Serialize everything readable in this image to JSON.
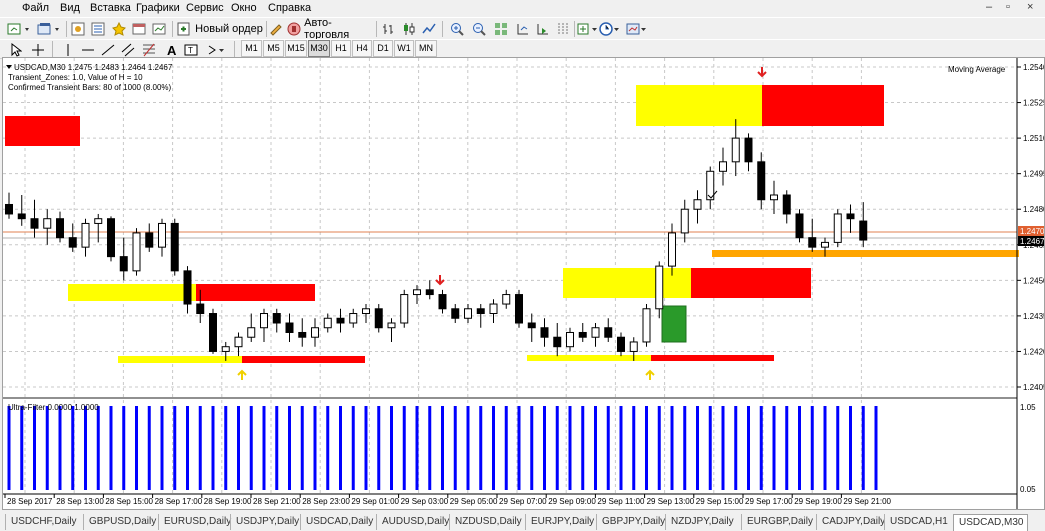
{
  "menu": [
    "Файл",
    "Вид",
    "Вставка",
    "Графики",
    "Сервис",
    "Окно",
    "Справка"
  ],
  "window_controls": [
    "–",
    "▫",
    "×"
  ],
  "toolbar1": {
    "new_order": "Новый ордер",
    "autotrading": "Авто-торговля"
  },
  "timeframes": [
    "M1",
    "M5",
    "M15",
    "M30",
    "H1",
    "H4",
    "D1",
    "W1",
    "MN"
  ],
  "active_timeframe": "M30",
  "chart": {
    "info_line1": "USDCAD,M30  1.2475 1.2483 1.2464 1.2467",
    "info_line2": "Transient_Zones: 1.0, Value of H = 10",
    "info_line3": "Confirmed Transient Bars: 80 of 1000 (8.00%)",
    "moving_average_label": "Moving Average",
    "price_ticks": [
      "1.2540",
      "1.2525",
      "1.2510",
      "1.2495",
      "1.2480",
      "1.2465",
      "1.2450",
      "1.2435",
      "1.2420",
      "1.2405"
    ],
    "current_price": "1.2467",
    "line_price": "1.2470",
    "indicator_label": "Ultra-Filter 0.0000 1.0000",
    "indicator_ticks": [
      "1.05",
      "0.05"
    ],
    "time_ticks": [
      "28 Sep 2017",
      "28 Sep 13:00",
      "28 Sep 15:00",
      "28 Sep 17:00",
      "28 Sep 19:00",
      "28 Sep 21:00",
      "28 Sep 23:00",
      "29 Sep 01:00",
      "29 Sep 03:00",
      "29 Sep 05:00",
      "29 Sep 07:00",
      "29 Sep 09:00",
      "29 Sep 11:00",
      "29 Sep 13:00",
      "29 Sep 15:00",
      "29 Sep 17:00",
      "29 Sep 19:00",
      "29 Sep 21:00"
    ]
  },
  "tabs": [
    "USDCHF,Daily",
    "GBPUSD,Daily",
    "EURUSD,Daily",
    "USDJPY,Daily",
    "USDCAD,Daily",
    "AUDUSD,Daily",
    "NZDUSD,Daily",
    "EURJPY,Daily",
    "GBPJPY,Daily",
    "NZDJPY,Daily",
    "EURGBP,Daily",
    "CADJPY,Daily",
    "USDCAD,H1",
    "USDCAD,M30"
  ],
  "active_tab": "USDCAD,M30",
  "colors": {
    "bull": "#ffffff",
    "bear": "#000000",
    "zone_yellow": "#ffff00",
    "zone_red": "#ff0000",
    "histogram": "#0000ff",
    "orange": "#ffa500",
    "grid": "#c8c8c8"
  },
  "candles": [
    [
      1.2482,
      1.2487,
      1.2476,
      1.2478
    ],
    [
      1.2478,
      1.2486,
      1.2473,
      1.2476
    ],
    [
      1.2476,
      1.2484,
      1.2468,
      1.2472
    ],
    [
      1.2472,
      1.248,
      1.2465,
      1.2476
    ],
    [
      1.2476,
      1.2479,
      1.2466,
      1.2468
    ],
    [
      1.2468,
      1.2474,
      1.2462,
      1.2464
    ],
    [
      1.2464,
      1.2476,
      1.246,
      1.2474
    ],
    [
      1.2474,
      1.2478,
      1.2466,
      1.2476
    ],
    [
      1.2476,
      1.2477,
      1.2458,
      1.246
    ],
    [
      1.246,
      1.2468,
      1.245,
      1.2454
    ],
    [
      1.2454,
      1.2472,
      1.2452,
      1.247
    ],
    [
      1.247,
      1.2474,
      1.2462,
      1.2464
    ],
    [
      1.2464,
      1.2476,
      1.246,
      1.2474
    ],
    [
      1.2474,
      1.2476,
      1.2452,
      1.2454
    ],
    [
      1.2454,
      1.2456,
      1.2436,
      1.244
    ],
    [
      1.244,
      1.2446,
      1.2432,
      1.2436
    ],
    [
      1.2436,
      1.2438,
      1.2419,
      1.242
    ],
    [
      1.242,
      1.2424,
      1.2416,
      1.2422
    ],
    [
      1.2422,
      1.2428,
      1.2418,
      1.2426
    ],
    [
      1.2426,
      1.2436,
      1.2424,
      1.243
    ],
    [
      1.243,
      1.2438,
      1.2424,
      1.2436
    ],
    [
      1.2436,
      1.2438,
      1.2428,
      1.2432
    ],
    [
      1.2432,
      1.2436,
      1.2424,
      1.2428
    ],
    [
      1.2428,
      1.2434,
      1.2422,
      1.2426
    ],
    [
      1.2426,
      1.2434,
      1.2422,
      1.243
    ],
    [
      1.243,
      1.2436,
      1.2428,
      1.2434
    ],
    [
      1.2434,
      1.2438,
      1.2428,
      1.2432
    ],
    [
      1.2432,
      1.2438,
      1.243,
      1.2436
    ],
    [
      1.2436,
      1.244,
      1.2432,
      1.2438
    ],
    [
      1.2438,
      1.244,
      1.2428,
      1.243
    ],
    [
      1.243,
      1.2434,
      1.2424,
      1.2432
    ],
    [
      1.2432,
      1.2446,
      1.243,
      1.2444
    ],
    [
      1.2444,
      1.2448,
      1.244,
      1.2446
    ],
    [
      1.2446,
      1.245,
      1.2442,
      1.2444
    ],
    [
      1.2444,
      1.2446,
      1.2436,
      1.2438
    ],
    [
      1.2438,
      1.244,
      1.2432,
      1.2434
    ],
    [
      1.2434,
      1.244,
      1.2432,
      1.2438
    ],
    [
      1.2438,
      1.244,
      1.243,
      1.2436
    ],
    [
      1.2436,
      1.2442,
      1.2432,
      1.244
    ],
    [
      1.244,
      1.2446,
      1.2438,
      1.2444
    ],
    [
      1.2444,
      1.2446,
      1.243,
      1.2432
    ],
    [
      1.2432,
      1.2436,
      1.2424,
      1.243
    ],
    [
      1.243,
      1.2434,
      1.2422,
      1.2426
    ],
    [
      1.2426,
      1.2432,
      1.2418,
      1.2422
    ],
    [
      1.2422,
      1.243,
      1.242,
      1.2428
    ],
    [
      1.2428,
      1.2432,
      1.2424,
      1.2426
    ],
    [
      1.2426,
      1.2432,
      1.2422,
      1.243
    ],
    [
      1.243,
      1.2434,
      1.2424,
      1.2426
    ],
    [
      1.2426,
      1.2428,
      1.2418,
      1.242
    ],
    [
      1.242,
      1.2426,
      1.2416,
      1.2424
    ],
    [
      1.2424,
      1.244,
      1.2422,
      1.2438
    ],
    [
      1.2438,
      1.2458,
      1.2434,
      1.2456
    ],
    [
      1.2456,
      1.2474,
      1.2452,
      1.247
    ],
    [
      1.247,
      1.2484,
      1.2466,
      1.248
    ],
    [
      1.248,
      1.2488,
      1.2474,
      1.2484
    ],
    [
      1.2484,
      1.2498,
      1.248,
      1.2496
    ],
    [
      1.2496,
      1.2506,
      1.249,
      1.25
    ],
    [
      1.25,
      1.2518,
      1.2494,
      1.251
    ],
    [
      1.251,
      1.2512,
      1.2496,
      1.25
    ],
    [
      1.25,
      1.2504,
      1.248,
      1.2484
    ],
    [
      1.2484,
      1.2492,
      1.2478,
      1.2486
    ],
    [
      1.2486,
      1.2488,
      1.2474,
      1.2478
    ],
    [
      1.2478,
      1.248,
      1.2466,
      1.2468
    ],
    [
      1.2468,
      1.2476,
      1.2462,
      1.2464
    ],
    [
      1.2464,
      1.2468,
      1.246,
      1.2466
    ],
    [
      1.2466,
      1.248,
      1.2464,
      1.2478
    ],
    [
      1.2478,
      1.2482,
      1.247,
      1.2476
    ],
    [
      1.2475,
      1.2483,
      1.2464,
      1.2467
    ]
  ]
}
